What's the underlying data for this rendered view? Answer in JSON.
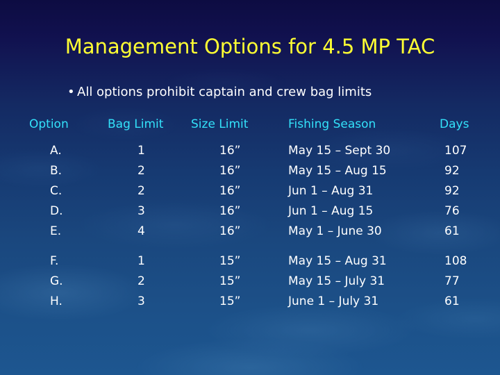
{
  "slide": {
    "title": "Management Options for 4.5 MP TAC",
    "bullet_marker": "•",
    "bullet_text": "All options prohibit captain and crew bag limits",
    "title_color": "#ffff33",
    "header_color": "#33e2fa",
    "body_color": "#ffffff",
    "background_top_color": "#0d0c42",
    "background_bottom_color": "#1d5690"
  },
  "table": {
    "headers": {
      "option": "Option",
      "bag_limit": "Bag Limit",
      "size_limit": "Size Limit",
      "fishing_season": "Fishing Season",
      "days": "Days"
    },
    "groups": [
      {
        "rows": [
          {
            "option": "A.",
            "bag_limit": "1",
            "size_limit": "16”",
            "fishing_season": "May 15 – Sept 30",
            "days": "107"
          },
          {
            "option": "B.",
            "bag_limit": "2",
            "size_limit": "16”",
            "fishing_season": "May 15 – Aug 15",
            "days": "92"
          },
          {
            "option": "C.",
            "bag_limit": "2",
            "size_limit": "16”",
            "fishing_season": "Jun 1 – Aug 31",
            "days": "92"
          },
          {
            "option": "D.",
            "bag_limit": "3",
            "size_limit": "16”",
            "fishing_season": "Jun 1 – Aug 15",
            "days": "76"
          },
          {
            "option": "E.",
            "bag_limit": "4",
            "size_limit": "16”",
            "fishing_season": "May 1 – June 30",
            "days": "61"
          }
        ]
      },
      {
        "rows": [
          {
            "option": "F.",
            "bag_limit": "1",
            "size_limit": "15”",
            "fishing_season": "May 15 – Aug 31",
            "days": "108"
          },
          {
            "option": "G.",
            "bag_limit": "2",
            "size_limit": "15”",
            "fishing_season": "May 15 – July 31",
            "days": "77"
          },
          {
            "option": "H.",
            "bag_limit": "3",
            "size_limit": "15”",
            "fishing_season": "June 1 – July 31",
            "days": "61"
          }
        ]
      }
    ]
  }
}
